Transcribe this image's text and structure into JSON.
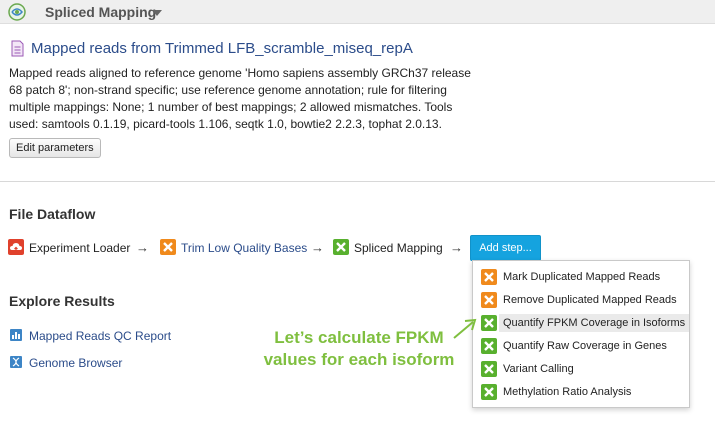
{
  "app": {
    "title": "Spliced Mapping"
  },
  "file": {
    "title": "Mapped reads from Trimmed LFB_scramble_miseq_repA",
    "description": "Mapped reads aligned to reference genome 'Homo sapiens assembly GRCh37 release 68 patch 8'; non-strand specific; use reference genome annotation; rule for filtering multiple mappings: None; 1 number of best mappings; 2 allowed mismatches. Tools used: samtools 0.1.19, picard-tools 1.106, seqtk 1.0, bowtie2 2.2.3, tophat 2.0.13.",
    "edit_label": "Edit parameters"
  },
  "dataflow": {
    "heading": "File Dataflow",
    "arrow": "→",
    "steps": [
      {
        "label": "Experiment Loader",
        "icon": "cloud-upload-icon",
        "color": "#e0412c"
      },
      {
        "label": "Trim Low Quality Bases",
        "icon": "x-app-icon",
        "color": "#f08a1c"
      },
      {
        "label": "Spliced Mapping",
        "icon": "x-app-icon",
        "color": "#58b02e"
      }
    ],
    "add_step_label": "Add step...",
    "menu": [
      {
        "label": "Mark Duplicated Mapped Reads",
        "color": "#f08a1c"
      },
      {
        "label": "Remove Duplicated Mapped Reads",
        "color": "#f08a1c"
      },
      {
        "label": "Quantify FPKM Coverage in Isoforms",
        "color": "#58b02e"
      },
      {
        "label": "Quantify Raw Coverage in Genes",
        "color": "#58b02e"
      },
      {
        "label": "Variant Calling",
        "color": "#58b02e"
      },
      {
        "label": "Methylation Ratio Analysis",
        "color": "#58b02e"
      }
    ]
  },
  "explore": {
    "heading": "Explore Results",
    "items": [
      {
        "label": "Mapped Reads QC Report",
        "icon": "report-icon"
      },
      {
        "label": "Genome Browser",
        "icon": "dna-icon"
      }
    ]
  },
  "annotation": {
    "line1": "Let’s calculate FPKM",
    "line2": "values for each isoform",
    "color": "#7fbf3f"
  }
}
